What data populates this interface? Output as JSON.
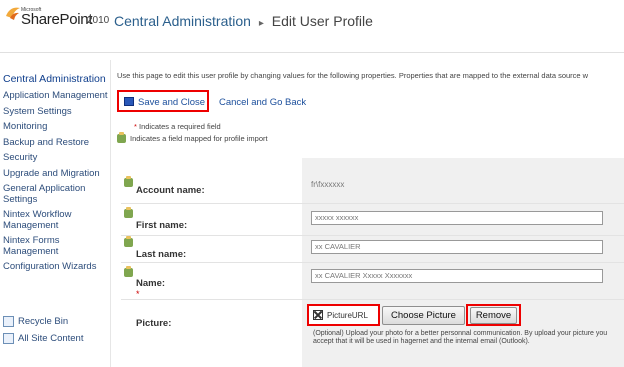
{
  "header": {
    "ms_small": "Microsoft",
    "product": "SharePoint",
    "version": "2010",
    "breadcrumb_root": "Central Administration",
    "separator": "▸",
    "breadcrumb_current": "Edit User Profile"
  },
  "nav": {
    "title": "Central Administration",
    "items": [
      "Application Management",
      "System Settings",
      "Monitoring",
      "Backup and Restore",
      "Security",
      "Upgrade and Migration",
      "General Application Settings",
      "Nintex Workflow Management",
      "Nintex Forms Management",
      "Configuration Wizards"
    ],
    "bottom": [
      "Recycle Bin",
      "All Site Content"
    ]
  },
  "page": {
    "description": "Use this page to edit this user profile by changing values for the following properties. Properties that are mapped to the external data source w",
    "save_label": "Save and Close",
    "cancel_label": "Cancel and Go Back",
    "required_star": "*",
    "required_note": " Indicates a required field",
    "mapped_note": "Indicates a field mapped for profile import"
  },
  "form": {
    "account_label": "Account name:",
    "account_value": "fr\\fxxxxxx",
    "first_label": "First name:",
    "first_value": "xxxxx xxxxxx",
    "last_label": "Last name:",
    "last_value": "xx CAVALIER",
    "name_label": "Name:",
    "name_star": "*",
    "name_value": "xx CAVALIER Xxxxx Xxxxxxx",
    "picture_label": "Picture:",
    "picture_url": "PictureURL",
    "choose_label": "Choose Picture",
    "remove_label": "Remove",
    "picture_help": "(Optional) Upload your photo for a better personnal communication. By upload your picture you accept that it will be used in hagernet and the internal email (Outlook)."
  },
  "colors": {
    "link": "#1c4f9c",
    "highlight": "#e00000",
    "nav_title": "#0f3e8c"
  }
}
